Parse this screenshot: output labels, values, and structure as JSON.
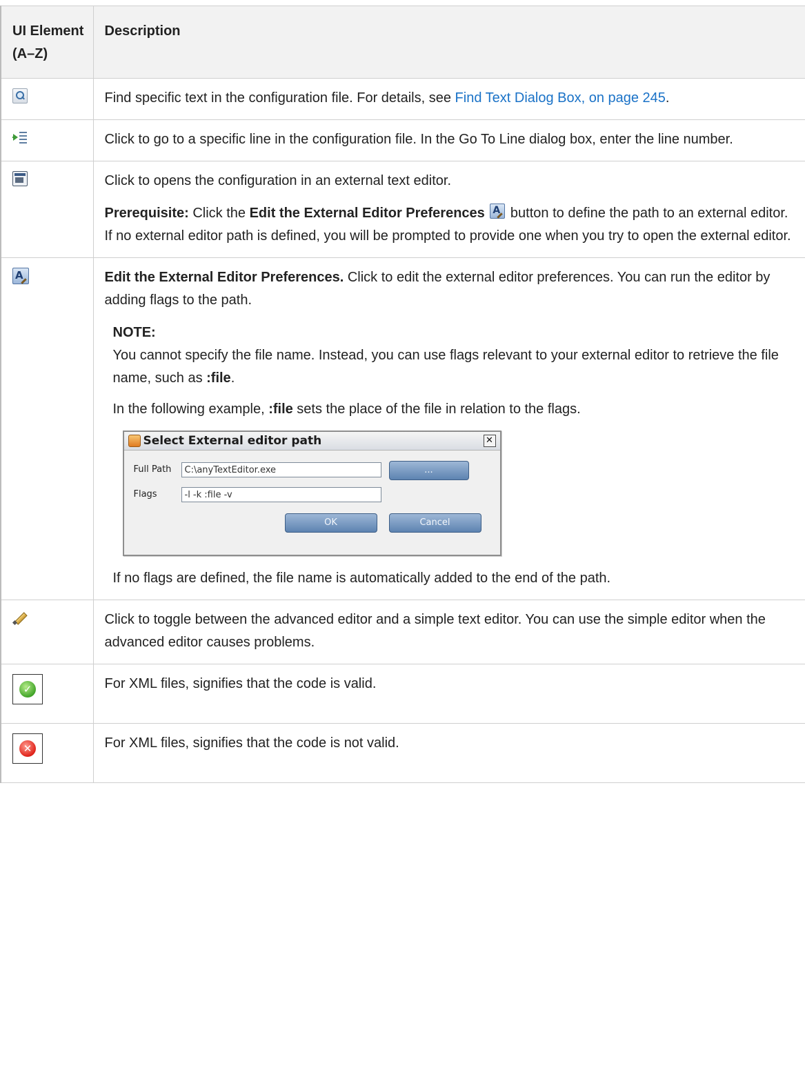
{
  "table": {
    "header": {
      "col1": "UI Element (A–Z)",
      "col2": "Description"
    },
    "rows": {
      "find": {
        "icon": "find-icon",
        "text": "Find specific text in the configuration file. For details, see ",
        "link": "Find Text Dialog Box, on page 245",
        "after": "."
      },
      "goto": {
        "icon": "go-to-line-icon",
        "text": "Click to go to a specific line in the configuration file. In the Go To Line dialog box, enter the line number."
      },
      "external": {
        "icon": "external-editor-icon",
        "text": "Click to opens the configuration in an external text editor.",
        "prereq_label": "Prerequisite:",
        "prereq_a": " Click the ",
        "prereq_bold": "Edit the External Editor Preferences",
        "prereq_b": " button to define the path to an external editor. If no external editor path is defined, you will be prompted to provide one when you try to open the external editor."
      },
      "prefs": {
        "icon": "edit-preferences-icon",
        "title": "Edit the External Editor Preferences.",
        "text": " Click to edit the external editor preferences. You can run the editor by adding flags to the path.",
        "note_title": "NOTE:",
        "note_a": "You cannot specify the file name. Instead, you can use flags relevant to your external editor to retrieve the file name, such as ",
        "note_flag": ":file",
        "note_end": ".",
        "example_a": "In the following example, ",
        "example_flag": ":file",
        "example_b": " sets the place of the file in relation to the flags.",
        "footer": "If no flags are defined, the file name is automatically added to the end of the path."
      },
      "toggle": {
        "icon": "pencil-icon",
        "text": "Click to toggle between the advanced editor and a simple text editor. You can use the simple editor when the advanced editor causes problems."
      },
      "valid": {
        "icon": "valid-check-icon",
        "text": "For XML files, signifies that the code is valid."
      },
      "invalid": {
        "icon": "invalid-x-icon",
        "text": "For XML files, signifies that the code is not valid."
      }
    }
  },
  "dialog": {
    "title": "Select External editor path",
    "close": "✕",
    "full_path_label": "Full Path",
    "full_path_value": "C:\\anyTextEditor.exe",
    "browse": "...",
    "flags_label": "Flags",
    "flags_value": "-l -k :file -v",
    "ok": "OK",
    "cancel": "Cancel"
  },
  "icons": {
    "valid_glyph": "✓",
    "invalid_glyph": "✕",
    "pref_glyph": "A"
  },
  "colors": {
    "link": "#1a72c7",
    "header_bg": "#f2f2f2",
    "border": "#cfcfcf"
  }
}
